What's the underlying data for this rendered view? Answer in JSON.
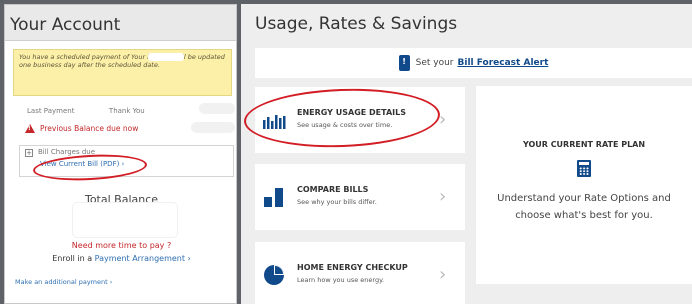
{
  "account": {
    "title": "Your Account",
    "notice_text": "You have a scheduled payment of          Your balance will be updated one business day after the scheduled date.",
    "last_payment_label": "Last Payment",
    "thank_you": "Thank You",
    "previous_balance": "Previous Balance due now",
    "bill_charges": "Bill Charges due",
    "view_bill": "View Current Bill (PDF) ›",
    "total_balance": "Total Balance",
    "more_time": "Need more time to pay ?",
    "enroll_prefix": "Enroll in a ",
    "enroll_link": "Payment Arrangement ›",
    "additional_payment": "Make an additional payment ›"
  },
  "usage": {
    "title": "Usage, Rates & Savings",
    "forecast_prefix": "Set your",
    "forecast_link": "Bill Forecast Alert",
    "cards": [
      {
        "title": "ENERGY USAGE DETAILS",
        "subtitle": "See usage & costs over time.",
        "icon": "bar-chart-icon"
      },
      {
        "title": "COMPARE BILLS",
        "subtitle": "See why your bills differ.",
        "icon": "compare-bars-icon"
      },
      {
        "title": "HOME ENERGY CHECKUP",
        "subtitle": "Learn how you use energy.",
        "icon": "pie-chart-icon"
      }
    ],
    "rate_plan": {
      "title": "YOUR CURRENT RATE PLAN",
      "description": "Understand your Rate Options and choose what's best for you.",
      "icon": "calculator-icon"
    }
  },
  "colors": {
    "brand_blue": "#114a8a",
    "alert_red": "#c4282b",
    "annotation_red": "#d21d25",
    "notice_yellow": "#fcf0a9"
  }
}
